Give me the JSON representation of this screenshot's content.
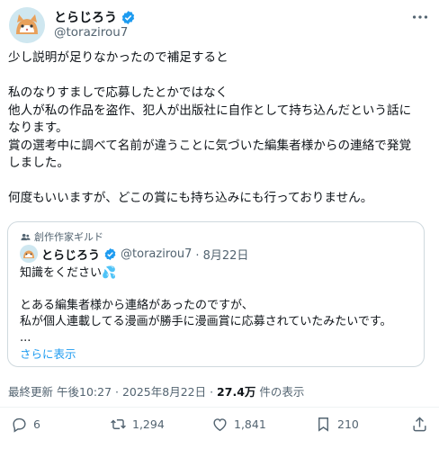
{
  "author": {
    "display_name": "とらじろう",
    "handle": "@torazirou7"
  },
  "post": {
    "paragraphs": [
      "少し説明が足りなかったので補足すると",
      "私のなりすましで応募したとかではなく\n他人が私の作品を盗作、犯人が出版社に自作として持ち込んだという話に\nなります。\n賞の選考中に調べて名前が違うことに気づいた編集者様からの連絡で発覚\nしました。",
      "何度もいいますが、どこの賞にも持ち込みにも行っておりません。"
    ]
  },
  "quote": {
    "community": "創作作家ギルド",
    "display_name": "とらじろう",
    "handle": "@torazirou7",
    "date": "· 8月22日",
    "text": [
      "知識をください💦",
      "とある編集者様から連絡があったのですが、\n私が個人連載してる漫画が勝手に漫画賞に応募されていたみたいです。\n..."
    ],
    "show_more": "さらに表示"
  },
  "meta": {
    "edited": "最終更新",
    "time": "午後10:27 · 2025年8月22日 ·",
    "views": "27.4万",
    "views_label": "件の表示"
  },
  "actions": {
    "replies": "6",
    "reposts": "1,294",
    "likes": "1,841",
    "bookmarks": "210"
  },
  "colors": {
    "accent": "#1d9bf0",
    "muted": "#536471",
    "border": "#cfd9de"
  },
  "icons": [
    "more-icon",
    "verified-badge-icon",
    "community-icon",
    "reply-icon",
    "repost-icon",
    "like-icon",
    "bookmark-icon",
    "share-icon"
  ]
}
